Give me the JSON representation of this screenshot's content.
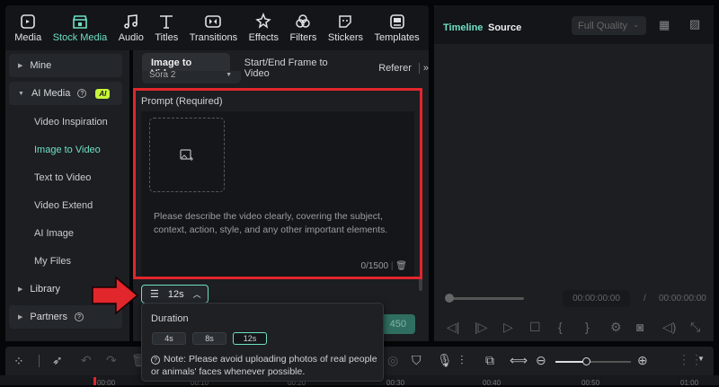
{
  "toolbar": {
    "items": [
      {
        "label": "Media",
        "icon": "media-icon"
      },
      {
        "label": "Stock Media",
        "icon": "stock-media-icon",
        "active": true
      },
      {
        "label": "Audio",
        "icon": "music-note-icon"
      },
      {
        "label": "Titles",
        "icon": "text-t-icon"
      },
      {
        "label": "Transitions",
        "icon": "transition-icon"
      },
      {
        "label": "Effects",
        "icon": "sparkle-icon"
      },
      {
        "label": "Filters",
        "icon": "filter-icon"
      },
      {
        "label": "Stickers",
        "icon": "sticker-icon"
      },
      {
        "label": "Templates",
        "icon": "template-icon"
      }
    ]
  },
  "sidebar": {
    "mine": "Mine",
    "ai_media": "AI Media",
    "ai_badge": "AI",
    "sub": [
      "Video Inspiration",
      "Image to Video",
      "Text to Video",
      "Video Extend",
      "AI Image",
      "My Files"
    ],
    "library": "Library",
    "partners": "Partners"
  },
  "content": {
    "tabs": [
      "Image to Video",
      "Start/End Frame to Video",
      "Referer"
    ],
    "model": "Sora 2",
    "prompt_label": "Prompt (Required)",
    "placeholder": "Please describe the video clearly, covering the subject, context, action, style, and any other important elements.",
    "count": "0/1500",
    "duration_button": "12s",
    "generate_cost": "450"
  },
  "popup": {
    "title": "Duration",
    "options": [
      "4s",
      "8s",
      "12s"
    ],
    "selected": "12s",
    "note": "Note: Please avoid uploading photos of real people or animals' faces whenever possible."
  },
  "preview": {
    "tab_timeline": "Timeline",
    "tab_source": "Source",
    "quality": "Full Quality",
    "current_time": "00:00:00:00",
    "sep": "/",
    "total_time": "00:00:00:00"
  },
  "ruler": [
    "00:00",
    "00:10",
    "00:20",
    "00:30",
    "00:40",
    "00:50",
    "01:00"
  ],
  "colors": {
    "accent": "#6fe0c6",
    "highlight": "#e1262c",
    "ai_badge": "#c8f53a"
  }
}
